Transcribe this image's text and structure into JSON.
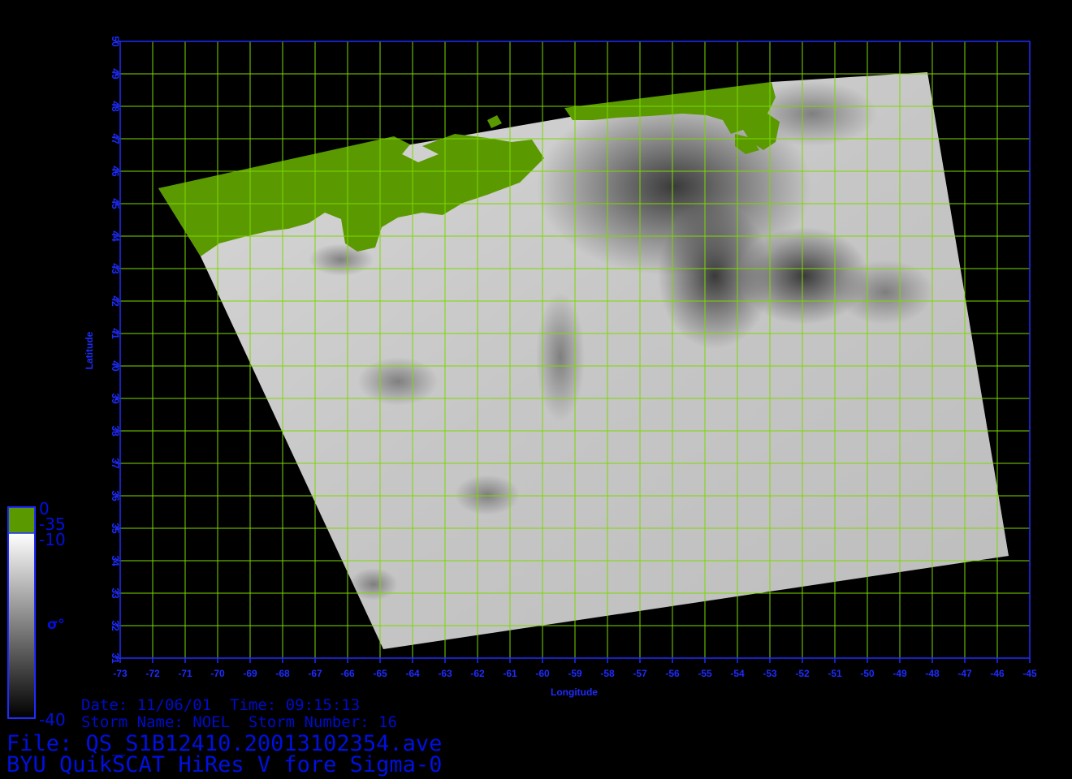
{
  "map": {
    "x_ticks": [
      "-73",
      "-72",
      "-71",
      "-70",
      "-69",
      "-68",
      "-67",
      "-66",
      "-65",
      "-64",
      "-63",
      "-62",
      "-61",
      "-60",
      "-59",
      "-58",
      "-57",
      "-56",
      "-55",
      "-54",
      "-53",
      "-52",
      "-51",
      "-50",
      "-49",
      "-48",
      "-47",
      "-46",
      "-45"
    ],
    "y_ticks": [
      "31",
      "32",
      "33",
      "34",
      "35",
      "36",
      "37",
      "38",
      "39",
      "40",
      "41",
      "42",
      "43",
      "44",
      "45",
      "46",
      "47",
      "48",
      "49",
      "50"
    ],
    "xlabel": "Longitude",
    "ylabel": "Latitude",
    "lon_range": [
      -73,
      -45
    ],
    "lat_range": [
      31,
      50
    ],
    "colors": {
      "axis": "#1e2cff",
      "grid": "#7cd800",
      "land": "#5a9a00",
      "background": "#000000"
    }
  },
  "colorbar": {
    "land_top": "0",
    "land_bottom": "-35",
    "gray_top": "-10",
    "gray_bottom": "-40",
    "symbol": "σ°"
  },
  "info": {
    "date_time": "Date: 11/06/01  Time: 09:15:13",
    "storm": "Storm Name: NOEL  Storm Number: 16",
    "file": "File: QS_S1B12410.20013102354.ave",
    "product": "BYU QuikSCAT HiRes V fore Sigma-0"
  }
}
